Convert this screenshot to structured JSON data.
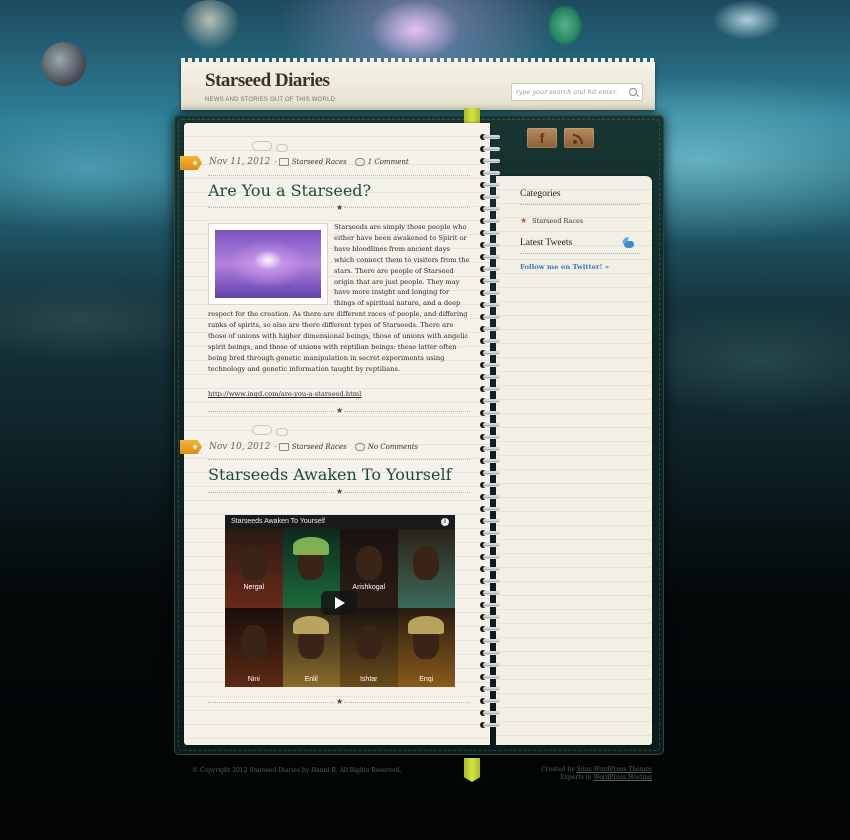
{
  "header": {
    "site_title": "Starseed Diaries",
    "tagline": "NEWS AND STORIES OUT OF THIS WORLD",
    "search_placeholder": "type your search and hit enter"
  },
  "posts": [
    {
      "date": "Nov 11, 2012",
      "separator": "-",
      "category": "Starseed Races",
      "comments": "1 Comment",
      "title": "Are You a Starseed?",
      "body": "Starseeds are simply those people who either have been awakened to Spirit or have bloodlines from ancient days which connect them to visitors from the stars. There are people of Starseed origin that are just people. They may have more insight and longing for things of spiritual nature, and a deep respect for the creation. As there are different races of people, and differing ranks of spirits, so also are there different types of Starseeds. There are those of unions with higher dimensional beings, those of unions with angelic spirit beings, and those of unions with reptilian beings: these latter often being bred through genetic manipulation in secret experiments using technology and genetic information taught by reptilians.",
      "source_url": "http://www.ingd.com/are-you-a-starseed.html"
    },
    {
      "date": "Nov 10, 2012",
      "separator": "-",
      "category": "Starseed Races",
      "comments": "No Comments",
      "title": "Starseeds Awaken To Yourself",
      "video": {
        "title": "Starseeds Awaken To Yourself",
        "info": "i",
        "labels": [
          "Nergal",
          "Arishkogal",
          "Nini",
          "Enlil",
          "Ishtar",
          "Enqi"
        ]
      }
    }
  ],
  "sidebar": {
    "categories_heading": "Categories",
    "categories": [
      "Starseed Races"
    ],
    "tweets_heading": "Latest Tweets",
    "follow_link": "Follow me on Twitter! »"
  },
  "social": {
    "facebook_label": "f"
  },
  "footer": {
    "copyright": "© Copyright 2012 Starseed Diaries by Hanni B. All Rights Reserved.",
    "created_by_prefix": "Created by",
    "created_by_link": "Sites WordPress Themes",
    "experts_prefix": "Experts in",
    "experts_link": "WordPress Hosting"
  },
  "colors": {
    "accent_green": "#1f4a3e",
    "link_blue": "#3a7ab8",
    "date_tab_orange": "#f5b635",
    "ribbon_green": "#c5d23a"
  }
}
